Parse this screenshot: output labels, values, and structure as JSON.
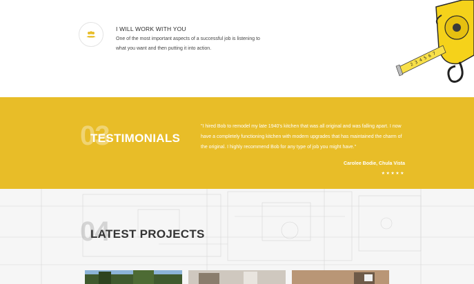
{
  "feature": {
    "title": "I WILL WORK WITH YOU",
    "text": "One of the most important aspects of a successful job is listening to what you want and then putting it into action.",
    "icon": "users-icon",
    "icon_color": "#e8bd28"
  },
  "testimonials": {
    "number": "03",
    "heading": "TESTIMONIALS",
    "quote": "\"I hired Bob to remodel my late 1940's kitchen that was all original and was falling apart. I now have a completely functioning kitchen with modern upgrades that has maintained the charm of the original. I highly recommend Bob for any type of job you might have.\"",
    "author": "Carolee Bodie, Chula Vista",
    "rating": 5,
    "stars": "★★★★★",
    "background": "#e8bd28"
  },
  "projects": {
    "number": "04",
    "heading": "LATEST PROJECTS",
    "thumbnails": [
      "project-photo-exterior",
      "project-photo-kitchen",
      "project-photo-interior"
    ]
  }
}
